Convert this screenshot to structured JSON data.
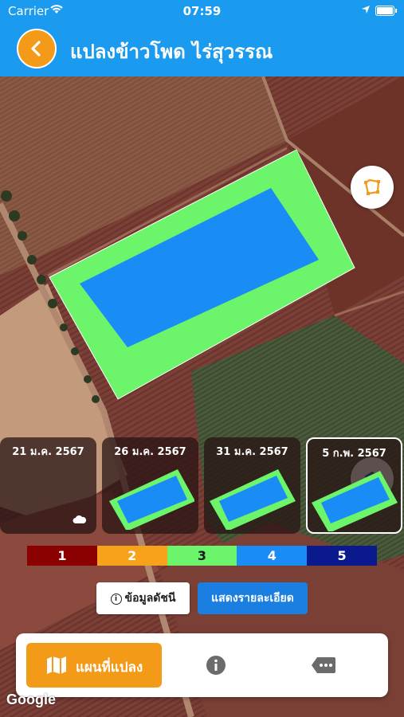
{
  "status_bar": {
    "carrier": "Carrier",
    "time": "07:59"
  },
  "header": {
    "title": "แปลงข้าวโพด ไร่สุวรรณ",
    "back_icon": "chevron-left-icon"
  },
  "map": {
    "buttons": {
      "draw": "draw-polygon-icon",
      "layers": "layers-icon"
    }
  },
  "timeline": [
    {
      "date": "21 ม.ค. 2567",
      "cloudy": true,
      "selected": false
    },
    {
      "date": "26 ม.ค. 2567",
      "cloudy": false,
      "selected": false
    },
    {
      "date": "31 ม.ค. 2567",
      "cloudy": false,
      "selected": false
    },
    {
      "date": "5 ก.พ. 2567",
      "cloudy": false,
      "selected": true
    }
  ],
  "legend": [
    {
      "label": "1",
      "color": "#8b0000",
      "text_color": "#ffffff"
    },
    {
      "label": "2",
      "color": "#f7a21b",
      "text_color": "#ffffff"
    },
    {
      "label": "3",
      "color": "#6cf46b",
      "text_color": "#1a1a1a"
    },
    {
      "label": "4",
      "color": "#1a8cf5",
      "text_color": "#ffffff"
    },
    {
      "label": "5",
      "color": "#0a1a8c",
      "text_color": "#ffffff"
    }
  ],
  "actions": {
    "index_info": "ข้อมูลดัชนี",
    "show_details": "แสดงรายละเอียด"
  },
  "bottom_tabs": {
    "map": "แผนที่แปลง",
    "info_icon": "info-icon",
    "more_icon": "more-icon"
  },
  "attribution": "Google",
  "colors": {
    "primary": "#1a9bf0",
    "accent": "#f39b18"
  }
}
